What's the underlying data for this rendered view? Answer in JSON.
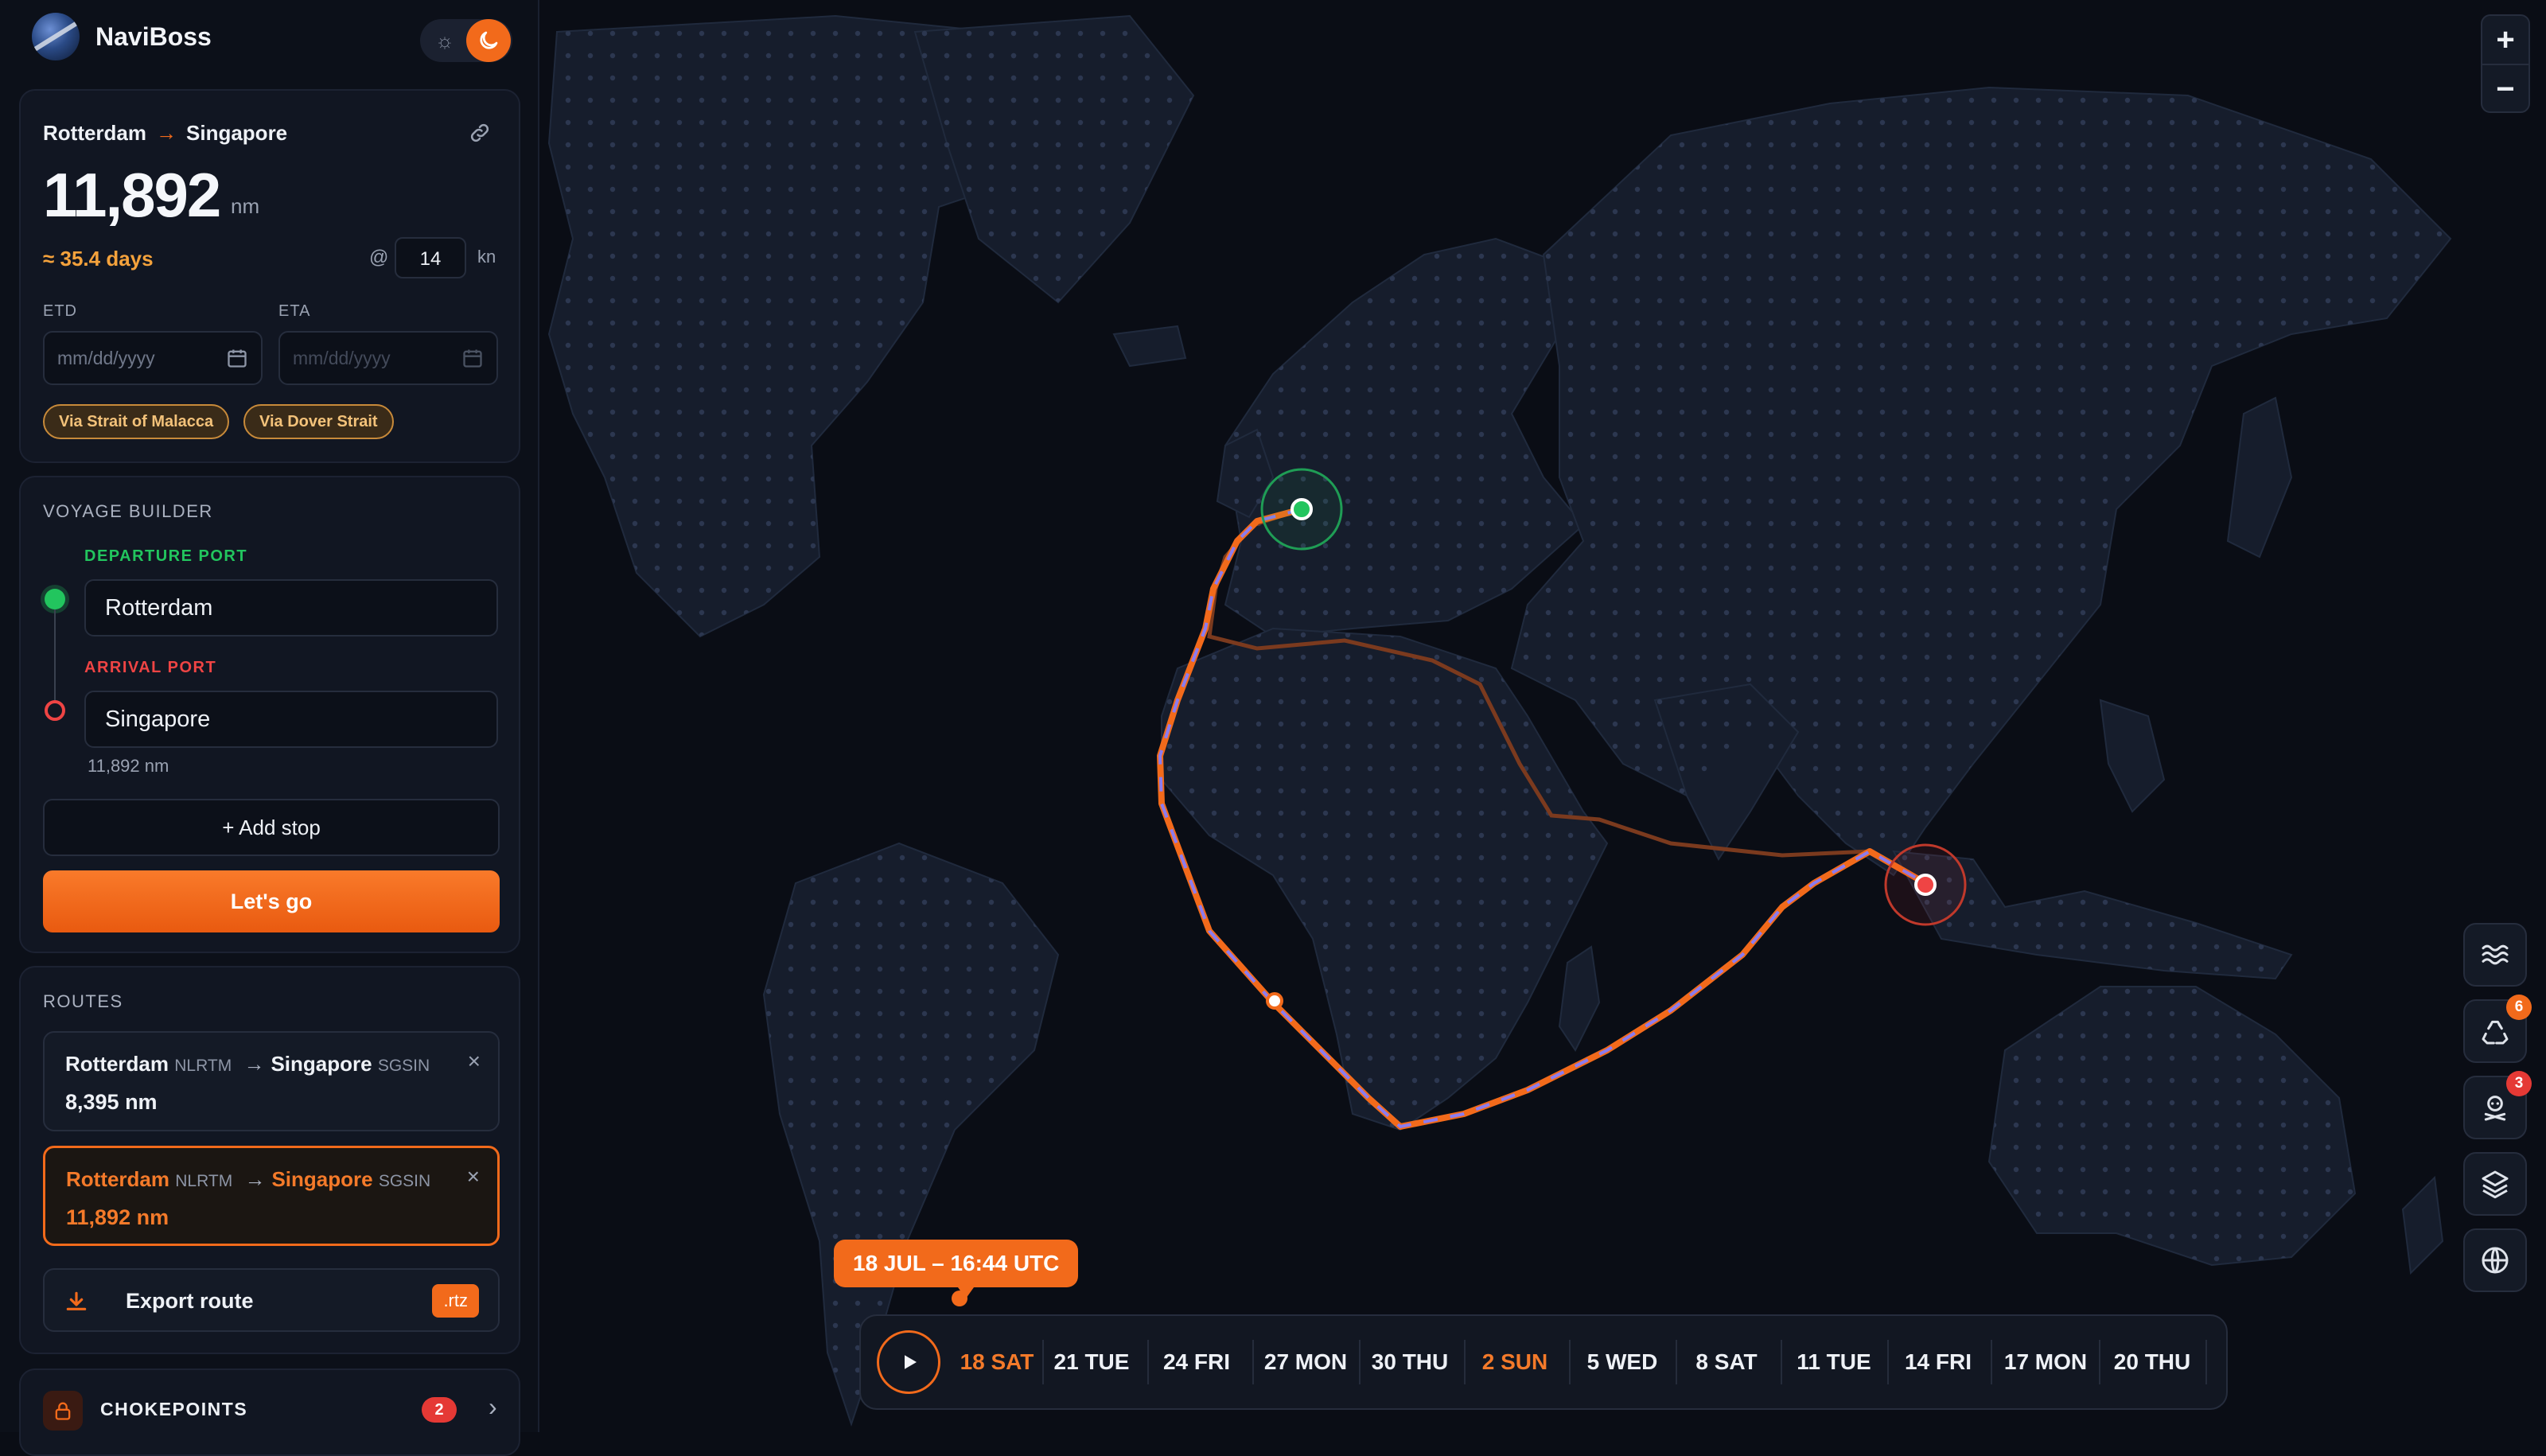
{
  "app": {
    "name": "NaviBoss"
  },
  "summary": {
    "from": "Rotterdam",
    "to": "Singapore",
    "arrow": "→",
    "distance": "11,892",
    "unit": "nm",
    "days": "≈ 35.4 days",
    "at": "@",
    "speed": "14",
    "speed_unit": "kn",
    "etd_label": "ETD",
    "eta_label": "ETA",
    "etd_placeholder": "mm/dd/yyyy",
    "eta_placeholder": "mm/dd/yyyy",
    "chips": [
      "Via Strait of Malacca",
      "Via Dover Strait"
    ]
  },
  "builder": {
    "title": "VOYAGE BUILDER",
    "departure_label": "DEPARTURE PORT",
    "departure_value": "Rotterdam",
    "arrival_label": "ARRIVAL PORT",
    "arrival_value": "Singapore",
    "sub_distance": "11,892 nm",
    "add_stop": "+ Add stop",
    "go": "Let's go"
  },
  "routes": {
    "title": "ROUTES",
    "items": [
      {
        "from": "Rotterdam",
        "from_code": "NLRTM",
        "arrow": "→",
        "to": "Singapore",
        "to_code": "SGSIN",
        "distance": "8,395 nm",
        "close": "×"
      },
      {
        "from": "Rotterdam",
        "from_code": "NLRTM",
        "arrow": "→",
        "to": "Singapore",
        "to_code": "SGSIN",
        "distance": "11,892 nm",
        "close": "×"
      }
    ],
    "export_label": "Export route",
    "export_badge": ".rtz"
  },
  "chokepoints": {
    "title": "CHOKEPOINTS",
    "count": "2",
    "chevron": "›"
  },
  "zoom": {
    "in": "+",
    "out": "−"
  },
  "tools": [
    {
      "icon": "waves-icon",
      "badge": ""
    },
    {
      "icon": "recycle-icon",
      "badge": "6"
    },
    {
      "icon": "pirate-icon",
      "badge": "3"
    },
    {
      "icon": "layers-icon",
      "badge": ""
    },
    {
      "icon": "globe-icon",
      "badge": ""
    }
  ],
  "timeline": {
    "current": "18 JUL – 16:44 UTC",
    "days": [
      "18 SAT",
      "21 TUE",
      "24 FRI",
      "27 MON",
      "30 THU",
      "2 SUN",
      "5 WED",
      "8 SAT",
      "11 TUE",
      "14 FRI",
      "17 MON",
      "20 THU"
    ],
    "highlighted": [
      "18 SAT",
      "2 SUN"
    ]
  },
  "colors": {
    "accent": "#f26a1b",
    "start": "#22c55e",
    "end": "#ef4444",
    "land": "#1a2233",
    "ocean": "#0a0d15",
    "route_alt": "#7b3a1e",
    "route_stripe": "#8b7cf0"
  }
}
